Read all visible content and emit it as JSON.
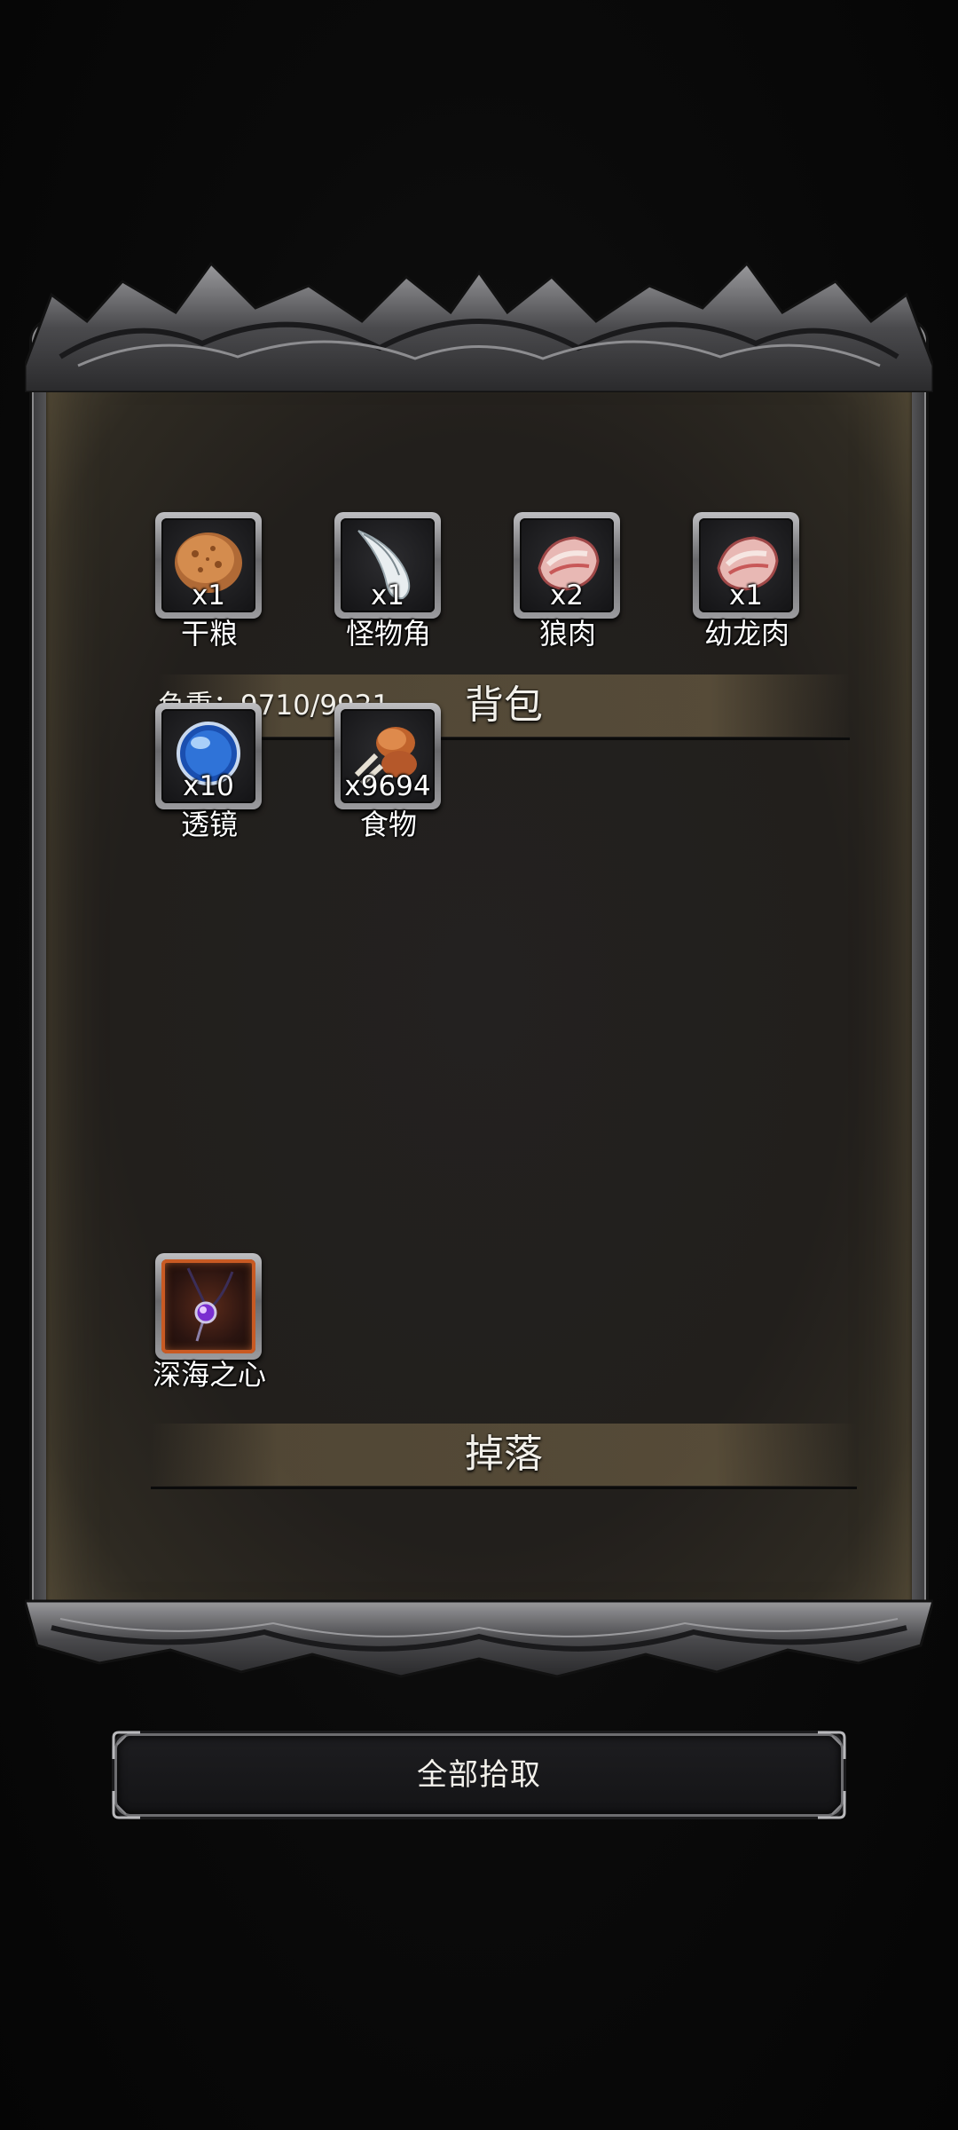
{
  "bag": {
    "title": "背包",
    "weight_label": "负重：9710/9921",
    "items": [
      {
        "name": "干粮",
        "qty": "x1",
        "icon": "dry-ration-icon"
      },
      {
        "name": "怪物角",
        "qty": "x1",
        "icon": "monster-horn-icon"
      },
      {
        "name": "狼肉",
        "qty": "x2",
        "icon": "wolf-meat-icon"
      },
      {
        "name": "幼龙肉",
        "qty": "x1",
        "icon": "dragon-meat-icon"
      },
      {
        "name": "透镜",
        "qty": "x10",
        "icon": "lens-orb-icon"
      },
      {
        "name": "食物",
        "qty": "x9694",
        "icon": "meat-drumstick-icon"
      }
    ]
  },
  "drops": {
    "title": "掉落",
    "items": [
      {
        "name": "深海之心",
        "icon": "amulet-pendant-icon",
        "rarity_color": "#c95a23"
      }
    ]
  },
  "actions": {
    "collect_all_label": "全部拾取"
  }
}
